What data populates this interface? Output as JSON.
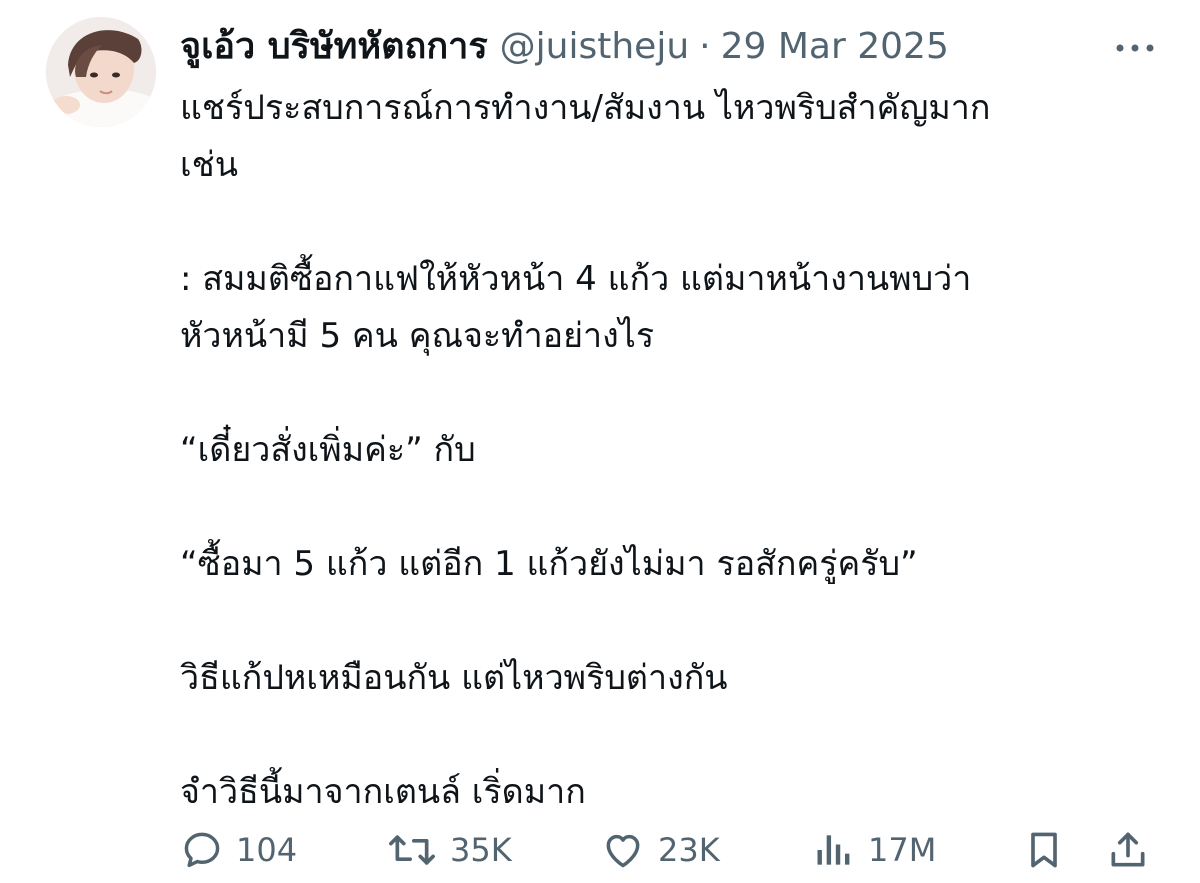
{
  "author": {
    "display_name": "จูเอ้ว บริษัทหัตถการ",
    "handle": "@juistheju",
    "separator": "·",
    "date": "29 Mar 2025"
  },
  "tweet": {
    "lines": [
      "แชร์ประสบการณ์การทำงาน/สัมงาน ไหวพริบสำคัญมาก",
      "เช่น",
      "",
      ": สมมติซื้อกาแฟให้หัวหน้า 4 แก้ว แต่มาหน้างานพบว่า",
      "หัวหน้ามี 5 คน คุณจะทำอย่างไร",
      "",
      "“เดี๋ยวสั่งเพิ่มค่ะ” กับ",
      "",
      "“ซื้อมา 5 แก้ว แต่อีก 1 แก้วยังไม่มา รอสักครู่ครับ”",
      "",
      "วิธีแก้ปหเหมือนกัน แต่ไหวพริบต่างกัน",
      "",
      "จำวิธีนี้มาจากเตนล์ เริ่ดมาก"
    ]
  },
  "actions": {
    "replies": "104",
    "retweets": "35K",
    "likes": "23K",
    "views": "17M"
  },
  "icons": {
    "more": "more-icon",
    "reply": "reply-icon",
    "retweet": "retweet-icon",
    "like": "heart-icon",
    "views": "views-icon",
    "bookmark": "bookmark-icon",
    "share": "share-icon"
  },
  "colors": {
    "text": "#0f1419",
    "secondary": "#536471",
    "background": "#ffffff"
  }
}
